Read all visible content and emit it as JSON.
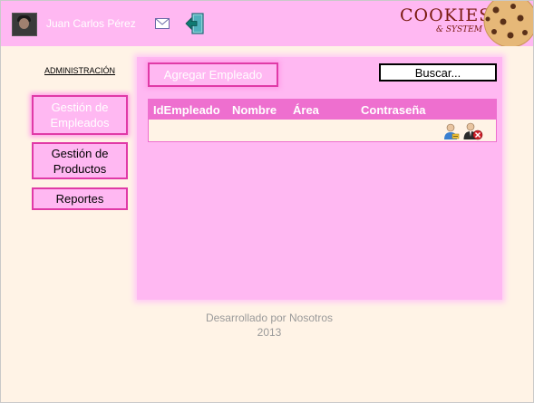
{
  "header": {
    "username": "Juan Carlos Pérez",
    "logo_main": "COOKIES",
    "logo_sub": "& SYSTEM"
  },
  "sidebar": {
    "title": "ADMINISTRACIÓN",
    "items": [
      {
        "label": "Gestión de Empleados",
        "active": true
      },
      {
        "label": "Gestión de Productos",
        "active": false
      },
      {
        "label": "Reportes",
        "active": false
      }
    ]
  },
  "main": {
    "add_button_label": "Agregar Empleado",
    "search_label": "Buscar..."
  },
  "table": {
    "columns": [
      "IdEmpleado",
      "Nombre",
      "Área",
      "Contraseña"
    ],
    "rows": [
      {
        "actions": [
          "edit-user-icon",
          "delete-user-icon"
        ]
      }
    ]
  },
  "footer": {
    "line1": "Desarrollado por Nosotros",
    "line2": "2013"
  },
  "colors": {
    "header_bg": "#ffb8f2",
    "accent_border": "#e03aa7",
    "table_header_bg": "#ee6fcf",
    "page_bg": "#fff3e6"
  }
}
